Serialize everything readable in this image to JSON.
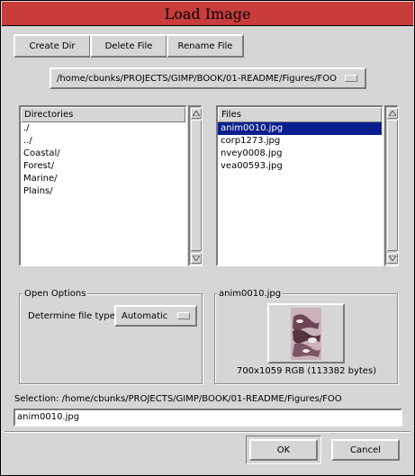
{
  "window": {
    "title": "Load Image"
  },
  "toolbar": {
    "create_dir": "Create Dir",
    "delete_file": "Delete File",
    "rename_file": "Rename File"
  },
  "path_menu": {
    "value": "/home/cbunks/PROJECTS/GIMP/BOOK/01-README/Figures/FOO"
  },
  "directories": {
    "header": "Directories",
    "items": [
      "./",
      "../",
      "Coastal/",
      "Forest/",
      "Marine/",
      "Plains/"
    ]
  },
  "files": {
    "header": "Files",
    "items": [
      "anim0010.jpg",
      "corp1273.jpg",
      "nvey0008.jpg",
      "vea00593.jpg"
    ],
    "selected_index": 0
  },
  "open_options": {
    "title": "Open Options",
    "file_type_label": "Determine file type:",
    "file_type_value": "Automatic"
  },
  "preview": {
    "title": "anim0010.jpg",
    "info": "700x1059 RGB (113382 bytes)"
  },
  "selection": {
    "label": "Selection: /home/cbunks/PROJECTS/GIMP/BOOK/01-README/Figures/FOO",
    "value": "anim0010.jpg"
  },
  "actions": {
    "ok": "OK",
    "cancel": "Cancel"
  },
  "colors": {
    "titlebar": "#c83c3c",
    "selection_bg": "#0a1f8f",
    "window_bg": "#d6d6d6"
  }
}
